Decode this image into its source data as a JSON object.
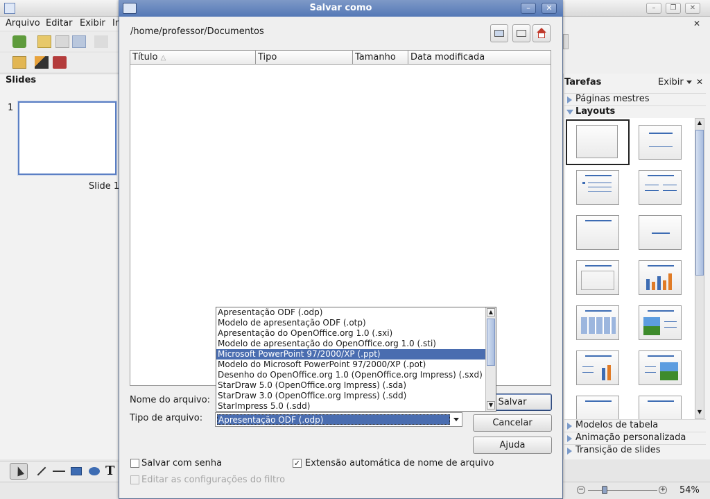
{
  "app": {
    "menu": [
      "Arquivo",
      "Editar",
      "Exibir",
      "In"
    ],
    "slides_panel_title": "Slides",
    "slide_number": "1",
    "slide_label": "Slide 1",
    "tasks_title": "Tarefas",
    "tasks_view": "Exibir",
    "task_sections": [
      {
        "label": "Páginas mestres",
        "expanded": false
      },
      {
        "label": "Layouts",
        "expanded": true
      },
      {
        "label": "Modelos de tabela",
        "expanded": false
      },
      {
        "label": "Animação personalizada",
        "expanded": false
      },
      {
        "label": "Transição de slides",
        "expanded": false
      }
    ],
    "zoom": "54%",
    "close_symbol": "✕",
    "text_tool": "T"
  },
  "dialog": {
    "title": "Salvar como",
    "path": "/home/professor/Documentos",
    "columns": [
      "Título",
      "Tipo",
      "Tamanho",
      "Data modificada"
    ],
    "sort_indicator": "△",
    "filename_label": "Nome do arquivo:",
    "filetype_label": "Tipo de arquivo:",
    "filetype_value": "Apresentação ODF (.odp)",
    "buttons": {
      "save": "Salvar",
      "cancel": "Cancelar",
      "help": "Ajuda"
    },
    "save_password_label": "Salvar com senha",
    "save_password_checked": false,
    "auto_extension_label": "Extensão automática de nome de arquivo",
    "auto_extension_checked": true,
    "auto_extension_checkmark": "✓",
    "edit_filter_label": "Editar as configurações do filtro",
    "edit_filter_enabled": false,
    "filetype_options": [
      "Apresentação ODF (.odp)",
      "Modelo de apresentação ODF (.otp)",
      "Apresentação do OpenOffice.org 1.0 (.sxi)",
      "Modelo de apresentação do OpenOffice.org 1.0 (.sti)",
      "Microsoft PowerPoint 97/2000/XP (.ppt)",
      "Modelo do Microsoft PowerPoint 97/2000/XP (.pot)",
      "Desenho do OpenOffice.org 1.0 (OpenOffice.org Impress) (.sxd)",
      "StarDraw 5.0 (OpenOffice.org Impress) (.sda)",
      "StarDraw 3.0 (OpenOffice.org Impress) (.sdd)",
      "StarImpress 5.0 (.sdd)"
    ],
    "highlighted_option_index": 4
  },
  "colors": {
    "accent": "#4a6db0",
    "titlebar": "#5478b6"
  }
}
